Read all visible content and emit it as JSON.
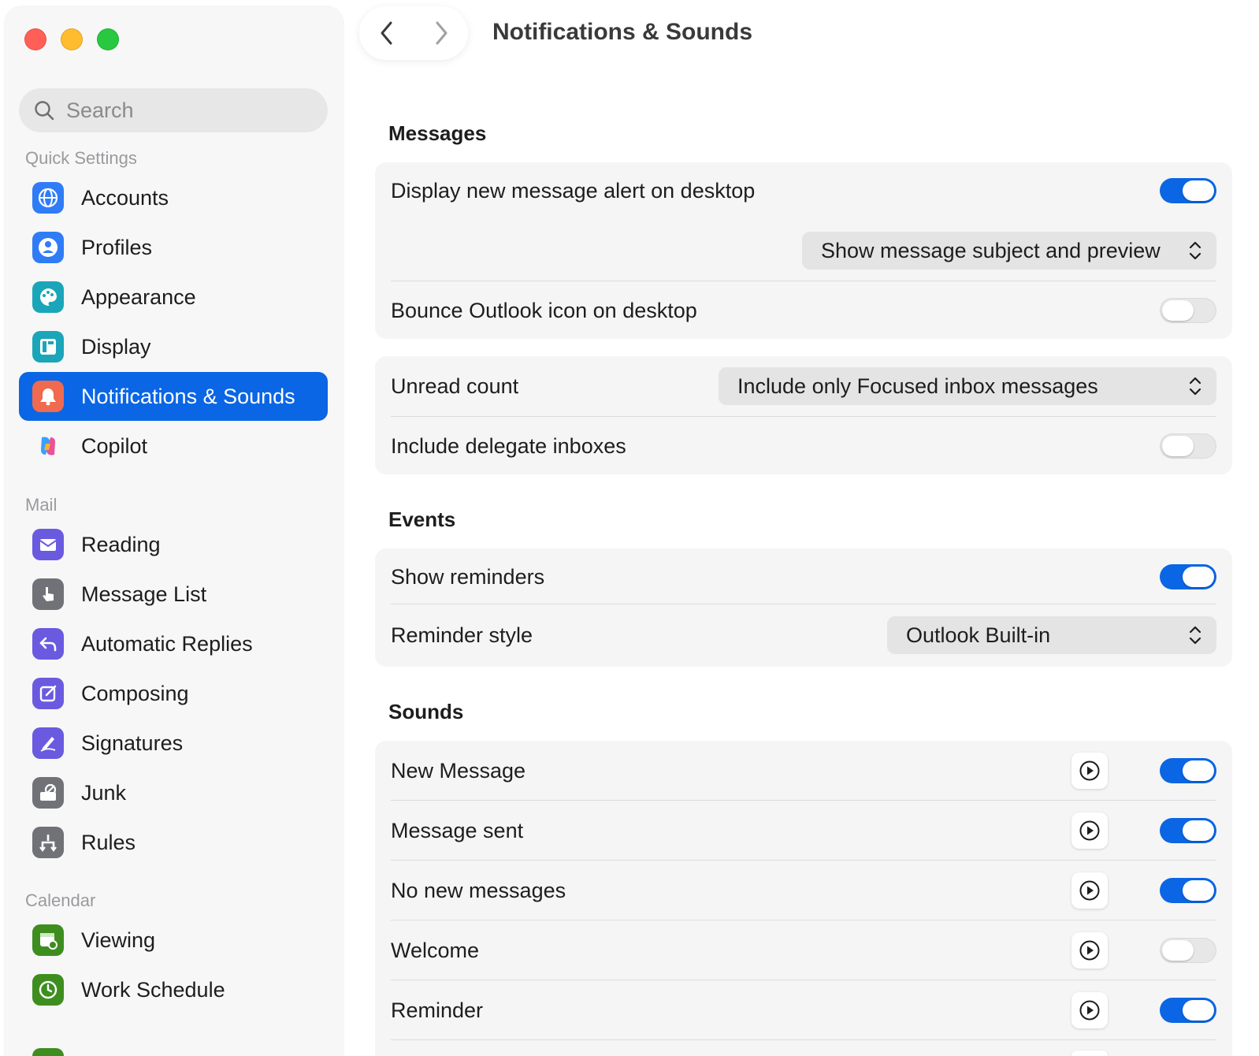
{
  "header": {
    "title": "Notifications & Sounds"
  },
  "search": {
    "placeholder": "Search"
  },
  "sidebar": {
    "sections": [
      {
        "label": "Quick Settings",
        "items": [
          {
            "label": "Accounts",
            "icon": "globe-icon",
            "color": "#2f7cf6"
          },
          {
            "label": "Profiles",
            "icon": "profile-icon",
            "color": "#2f7cf6"
          },
          {
            "label": "Appearance",
            "icon": "palette-icon",
            "color": "#1aa6b8"
          },
          {
            "label": "Display",
            "icon": "display-icon",
            "color": "#1aa6b8"
          },
          {
            "label": "Notifications & Sounds",
            "icon": "bell-icon",
            "color": "#ef6a4f",
            "selected": true
          },
          {
            "label": "Copilot",
            "icon": "copilot-icon",
            "color": "#ffffff"
          }
        ]
      },
      {
        "label": "Mail",
        "items": [
          {
            "label": "Reading",
            "icon": "envelope-icon",
            "color": "#6a5ae0"
          },
          {
            "label": "Message List",
            "icon": "hand-pointer-icon",
            "color": "#707278"
          },
          {
            "label": "Automatic Replies",
            "icon": "reply-icon",
            "color": "#6a5ae0"
          },
          {
            "label": "Composing",
            "icon": "compose-icon",
            "color": "#6a5ae0"
          },
          {
            "label": "Signatures",
            "icon": "signature-icon",
            "color": "#6a5ae0"
          },
          {
            "label": "Junk",
            "icon": "junk-icon",
            "color": "#707278"
          },
          {
            "label": "Rules",
            "icon": "rules-icon",
            "color": "#707278"
          }
        ]
      },
      {
        "label": "Calendar",
        "items": [
          {
            "label": "Viewing",
            "icon": "calendar-gear-icon",
            "color": "#3e8e1f"
          },
          {
            "label": "Work Schedule",
            "icon": "clock-icon",
            "color": "#3e8e1f"
          }
        ]
      }
    ]
  },
  "messages": {
    "title": "Messages",
    "display_alert_label": "Display new message alert on desktop",
    "display_alert_on": true,
    "preview_select": "Show message subject and preview",
    "bounce_label": "Bounce Outlook icon on desktop",
    "bounce_on": false
  },
  "unread": {
    "unread_count_label": "Unread count",
    "unread_select": "Include only Focused inbox messages",
    "delegate_label": "Include delegate inboxes",
    "delegate_on": false
  },
  "events": {
    "title": "Events",
    "reminders_label": "Show reminders",
    "reminders_on": true,
    "reminder_style_label": "Reminder style",
    "reminder_style_select": "Outlook Built-in"
  },
  "sounds": {
    "title": "Sounds",
    "items": [
      {
        "label": "New Message",
        "on": true
      },
      {
        "label": "Message sent",
        "on": true
      },
      {
        "label": "No new messages",
        "on": true
      },
      {
        "label": "Welcome",
        "on": false
      },
      {
        "label": "Reminder",
        "on": true
      }
    ]
  },
  "colors": {
    "accent": "#0a66e4",
    "sidebar_bg": "#f7f7f7",
    "card_bg": "#f5f5f5"
  }
}
